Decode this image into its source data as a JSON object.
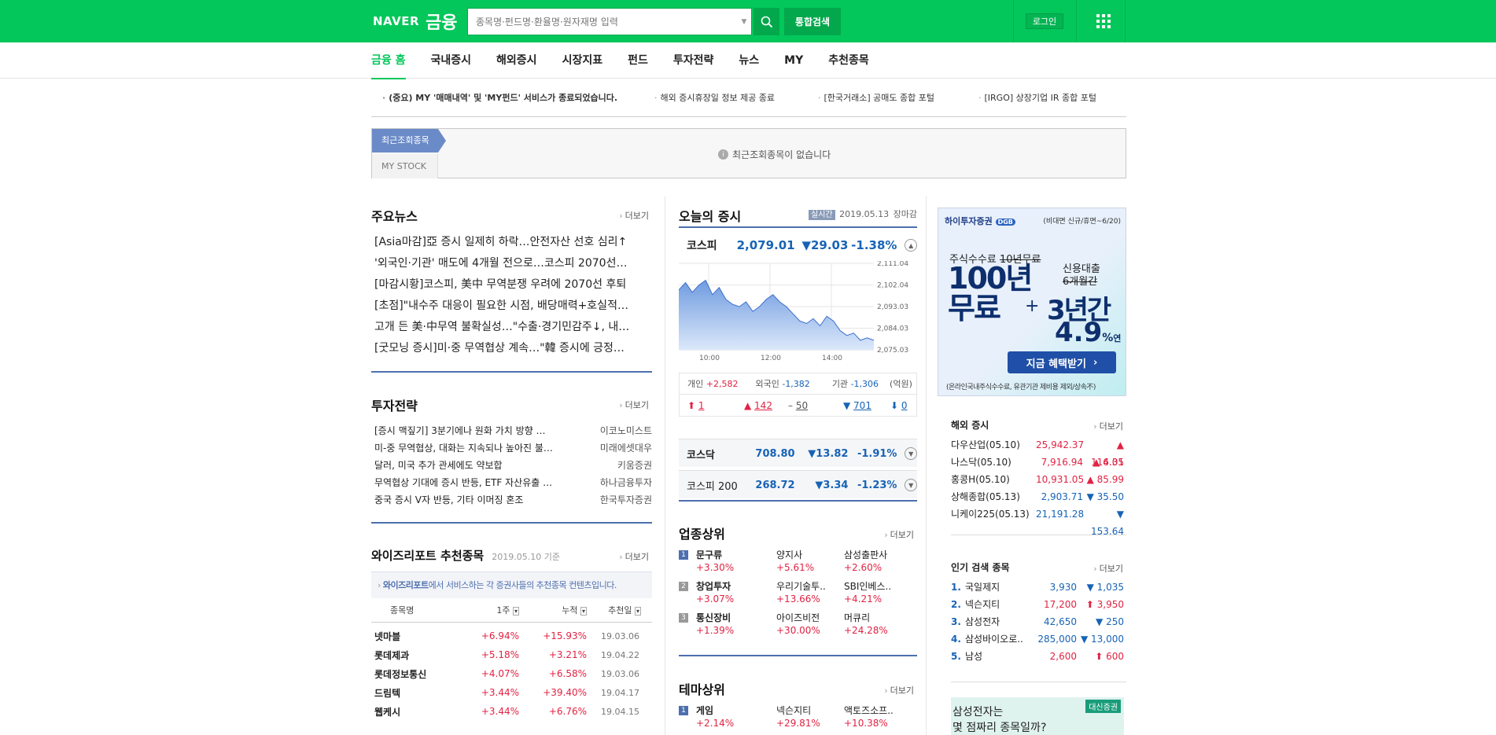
{
  "header": {
    "logo": "NAVER",
    "service": "금융",
    "search_placeholder": "종목명·펀드명·환율명·원자재명 입력",
    "total_search": "통합검색",
    "login": "로그인"
  },
  "nav": {
    "items": [
      "금융 홈",
      "국내증시",
      "해외증시",
      "시장지표",
      "펀드",
      "투자전략",
      "뉴스",
      "MY",
      "추천종목"
    ]
  },
  "notices": [
    "(중요) MY '매매내역' 및 'MY펀드' 서비스가 종료되었습니다.",
    "해외 증시휴장일 정보 제공 종료",
    "[한국거래소] 공매도 종합 포털",
    "[IRGO] 상장기업 IR 종합 포털"
  ],
  "recent": {
    "tab1": "최근조회종목",
    "tab2": "MY STOCK",
    "empty": "최근조회종목이 없습니다"
  },
  "main_news": {
    "title": "주요뉴스",
    "more": "더보기",
    "items": [
      "[Asia마감]亞 증시 일제히 하락…안전자산 선호 심리↑",
      "'외국인·기관' 매도에 4개월 전으로…코스피 2070선…",
      "[마감시황]코스피, 美中 무역분쟁 우려에 2070선 후퇴",
      "[초점]\"내수주 대응이 필요한 시점, 배당매력+호실적…",
      "고개 든 美·中무역 불확실성…\"수출·경기민감주↓, 내…",
      "[굿모닝 증시]미·중 무역협상 계속…\"韓 증시에 긍정…"
    ]
  },
  "strategy": {
    "title": "투자전략",
    "more": "더보기",
    "items": [
      {
        "t": "[증시 맥짚기] 3분기에나 원화 가치 방향 …",
        "s": "이코노미스트"
      },
      {
        "t": "미-중 무역협상, 대화는 지속되나 높아진 불…",
        "s": "미래에셋대우"
      },
      {
        "t": "달러, 미국 추가 관세에도 약보합",
        "s": "키움증권"
      },
      {
        "t": "무역협상 기대에 증시 반등, ETF 자산유출 …",
        "s": "하나금융투자"
      },
      {
        "t": "중국 증시 V자 반등, 기타 이머징 혼조",
        "s": "한국투자증권"
      }
    ]
  },
  "wise": {
    "title": "와이즈리포트 추천종목",
    "date": "2019.05.10 기준",
    "more": "더보기",
    "banner_strong": "와이즈리포트",
    "banner_rest": "에서 서비스하는 각 증권사들의 추천종목 컨텐츠입니다.",
    "headers": [
      "종목명",
      "1주",
      "누적",
      "추천일"
    ],
    "rows": [
      {
        "name": "넷마블",
        "w": "+6.94%",
        "c": "+15.93%",
        "d": "19.03.06"
      },
      {
        "name": "롯데제과",
        "w": "+5.18%",
        "c": "+3.21%",
        "d": "19.04.22"
      },
      {
        "name": "롯데정보통신",
        "w": "+4.07%",
        "c": "+6.58%",
        "d": "19.03.06"
      },
      {
        "name": "드림텍",
        "w": "+3.44%",
        "c": "+39.40%",
        "d": "19.04.17"
      },
      {
        "name": "웹케시",
        "w": "+3.44%",
        "c": "+6.76%",
        "d": "19.04.15"
      }
    ]
  },
  "market": {
    "title": "오늘의 증시",
    "live": "실시간",
    "date": "2019.05.13",
    "status": "장마감",
    "kospi": {
      "name": "코스피",
      "value": "2,079.01",
      "change": "▼29.03",
      "pct": "-1.38%"
    },
    "ylabels": [
      "2,111.04",
      "2,102.04",
      "2,093.03",
      "2,084.03",
      "2,075.03"
    ],
    "xlabels": [
      "10:00",
      "12:00",
      "14:00"
    ],
    "investors": {
      "p_label": "개인",
      "p": "+2,582",
      "f_label": "외국인",
      "f": "-1,382",
      "i_label": "기관",
      "i": "-1,306",
      "unit": "(억원)"
    },
    "counts": {
      "uplimit": "1",
      "up": "142",
      "flat": "50",
      "down": "701",
      "downlimit": "0"
    },
    "kosdaq": {
      "name": "코스닥",
      "value": "708.80",
      "change": "▼13.82",
      "pct": "-1.91%"
    },
    "kospi200": {
      "name": "코스피 200",
      "value": "268.72",
      "change": "▼3.34",
      "pct": "-1.23%"
    }
  },
  "chart_data": {
    "type": "area",
    "series": [
      {
        "values": [
          2100,
          2103,
          2099,
          2102,
          2104,
          2098,
          2101,
          2096,
          2094,
          2093,
          2095,
          2091,
          2093,
          2096,
          2098,
          2095,
          2093,
          2090,
          2087,
          2086,
          2088,
          2085,
          2089,
          2087,
          2083,
          2081,
          2082,
          2079,
          2080,
          2079
        ]
      }
    ],
    "ylim": [
      2075.03,
      2111.04
    ],
    "ylabels": [
      "2,111.04",
      "2,102.04",
      "2,093.03",
      "2,084.03",
      "2,075.03"
    ],
    "xlabels": [
      "10:00",
      "12:00",
      "14:00"
    ]
  },
  "industry": {
    "title": "업종상위",
    "more": "더보기",
    "rows": [
      {
        "rank": "1",
        "name": "문구류",
        "pct": "+3.30%",
        "s1": "양지사",
        "p1": "+5.61%",
        "s2": "삼성출판사",
        "p2": "+2.60%"
      },
      {
        "rank": "2",
        "name": "창업투자",
        "pct": "+3.07%",
        "s1": "우리기술투..",
        "p1": "+13.66%",
        "s2": "SBI인베스..",
        "p2": "+4.21%"
      },
      {
        "rank": "3",
        "name": "통신장비",
        "pct": "+1.39%",
        "s1": "아이즈비전",
        "p1": "+30.00%",
        "s2": "머큐리",
        "p2": "+24.28%"
      }
    ]
  },
  "theme": {
    "title": "테마상위",
    "more": "더보기",
    "rows": [
      {
        "rank": "1",
        "name": "게임",
        "pct": "+2.14%",
        "s1": "넥슨지티",
        "p1": "+29.81%",
        "s2": "액토즈소프..",
        "p2": "+10.38%"
      }
    ]
  },
  "ad": {
    "brand": "하이투자증권",
    "brand_badge": "DGB",
    "note": "(비대면 신규/휴면~6/20)",
    "t1": "주식수수료",
    "t1s": "10년무료",
    "big1": "100년",
    "big2": "무료",
    "plus": "+",
    "t2": "신용대출",
    "t2s": "6개월간",
    "big3": "3년간",
    "big4": "4.9",
    "big4u": "%",
    "big4y": "연",
    "cta": "지금 혜택받기",
    "foot": "(온라인국내주식수수료, 유관기관 제비용 제외/상속不)"
  },
  "world": {
    "title": "해외 증시",
    "more": "더보기",
    "rows": [
      {
        "n": "다우산업(05.10)",
        "v": "25,942.37",
        "c": "▲ 114.01",
        "d": "up"
      },
      {
        "n": "나스닥(05.10)",
        "v": "7,916.94",
        "c": "▲ 6.35",
        "d": "up"
      },
      {
        "n": "홍콩H(05.10)",
        "v": "10,931.05",
        "c": "▲ 85.99",
        "d": "up"
      },
      {
        "n": "상해종합(05.13)",
        "v": "2,903.71",
        "c": "▼ 35.50",
        "d": "down"
      },
      {
        "n": "니케이225(05.13)",
        "v": "21,191.28",
        "c": "▼ 153.64",
        "d": "down"
      }
    ]
  },
  "popular": {
    "title": "인기 검색 종목",
    "more": "더보기",
    "rows": [
      {
        "r": "1.",
        "n": "국일제지",
        "v": "3,930",
        "c": "▼ 1,035",
        "d": "down"
      },
      {
        "r": "2.",
        "n": "넥슨지티",
        "v": "17,200",
        "c": "⬆ 3,950",
        "d": "up"
      },
      {
        "r": "3.",
        "n": "삼성전자",
        "v": "42,650",
        "c": "▼ 250",
        "d": "down"
      },
      {
        "r": "4.",
        "n": "삼성바이오로..",
        "v": "285,000",
        "c": "▼ 13,000",
        "d": "down"
      },
      {
        "r": "5.",
        "n": "남성",
        "v": "2,600",
        "c": "⬆ 600",
        "d": "up"
      }
    ]
  },
  "ad2": {
    "text1": "삼성전자는",
    "text2": "몇 점짜리 종목일까?",
    "brand": "대신증권"
  }
}
